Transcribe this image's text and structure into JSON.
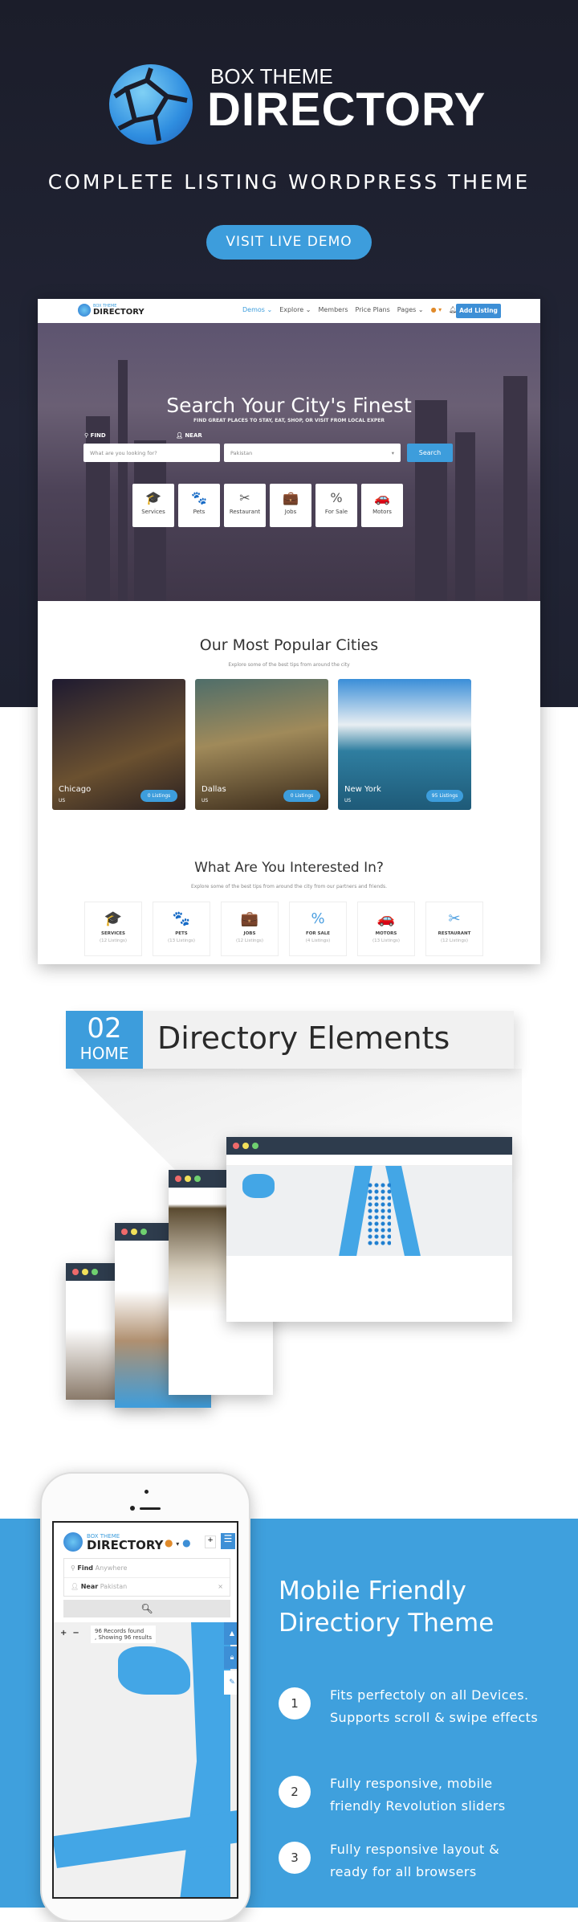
{
  "hero": {
    "logo_small": "BOX THEME",
    "logo_big": "DIRECTORY",
    "tagline": "COMPLETE LISTING WORDPRESS THEME",
    "demo_button": "VISIT LIVE DEMO"
  },
  "preview": {
    "nav": {
      "logo_small": "BOX THEME",
      "logo_big": "DIRECTORY",
      "links": [
        "Demos ⌄",
        "Explore ⌄",
        "Members",
        "Price Plans",
        "Pages ⌄"
      ],
      "add_listing": "Add Listing"
    },
    "hero_title": "Search Your City's Finest",
    "hero_subtitle": "FIND GREAT PLACES TO STAY, EAT, SHOP, OR VISIT FROM LOCAL EXPER",
    "find_label": "FIND",
    "find_placeholder": "What are you looking for?",
    "near_label": "NEAR",
    "near_value": "Pakistan",
    "search_button": "Search",
    "categories": [
      {
        "label": "Services",
        "icon": "graduation-cap-icon",
        "glyph": "🎓"
      },
      {
        "label": "Pets",
        "icon": "pets-icon",
        "glyph": "🐾"
      },
      {
        "label": "Restaurant",
        "icon": "fork-knife-icon",
        "glyph": "✂"
      },
      {
        "label": "Jobs",
        "icon": "briefcase-icon",
        "glyph": "💼"
      },
      {
        "label": "For Sale",
        "icon": "percent-badge-icon",
        "glyph": "%"
      },
      {
        "label": "Motors",
        "icon": "car-icon",
        "glyph": "🚗"
      }
    ],
    "cities_title": "Our Most Popular Cities",
    "cities_subtitle": "Explore some of the best tips from around the city",
    "cities": [
      {
        "name": "Chicago",
        "country": "US",
        "listings": "0 Listings"
      },
      {
        "name": "Dallas",
        "country": "US",
        "listings": "0 Listings"
      },
      {
        "name": "New York",
        "country": "US",
        "listings": "95 Listings"
      }
    ],
    "interest_title": "What Are You Interested In?",
    "interest_subtitle": "Explore some of the best tips from around the city from our partners and friends.",
    "interests": [
      {
        "label": "SERVICES",
        "count": "(12 Listings)",
        "glyph": "🎓"
      },
      {
        "label": "PETS",
        "count": "(13 Listings)",
        "glyph": "🐾"
      },
      {
        "label": "JOBS",
        "count": "(12 Listings)",
        "glyph": "💼"
      },
      {
        "label": "FOR SALE",
        "count": "(4 Listings)",
        "glyph": "%"
      },
      {
        "label": "MOTORS",
        "count": "(13 Listings)",
        "glyph": "🚗"
      },
      {
        "label": "RESTAURANT",
        "count": "(12 Listings)",
        "glyph": "✂"
      }
    ]
  },
  "banner": {
    "number": "02",
    "home": "HOME",
    "title": "Directory Elements"
  },
  "mobile": {
    "logo_small": "BOX THEME",
    "logo_big": "DIRECTORY",
    "find_label": "Find",
    "find_placeholder": "Anywhere",
    "near_label": "Near",
    "near_value": "Pakistan",
    "records": "96 Records found",
    "showing": ", Showing 96 results",
    "title_line1": "Mobile Friendly",
    "title_line2": "Directiory Theme",
    "features": [
      {
        "num": "1",
        "text": "Fits perfectoly on all Devices. Supports scroll & swipe effects"
      },
      {
        "num": "2",
        "text": "Fully responsive, mobile friendly Revolution sliders"
      },
      {
        "num": "3",
        "text": "Fully responsive layout & ready for all browsers"
      }
    ]
  },
  "colors": {
    "accent": "#3d9ddc",
    "dark_bg": "#1c1f2b",
    "window_bar": "#2e3c4d"
  }
}
